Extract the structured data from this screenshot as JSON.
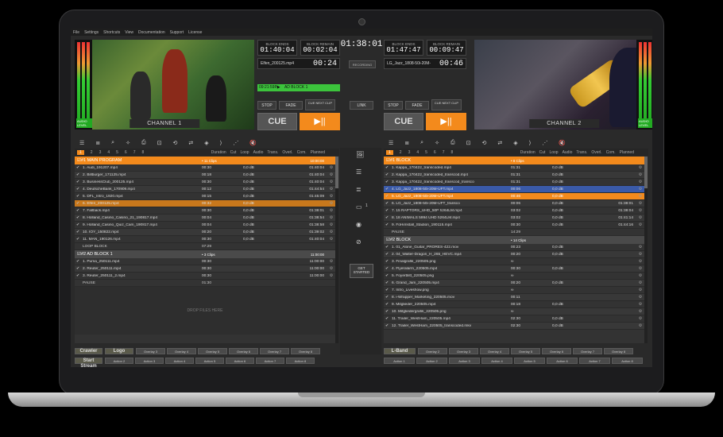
{
  "menu": [
    "File",
    "Settings",
    "Shortcuts",
    "View",
    "Documentation",
    "Support",
    "License"
  ],
  "clock": "01:38:01",
  "recording_label": "RECORDING",
  "link_label": "LINK",
  "channel1": {
    "label": "CHANNEL 1",
    "vu_caption": "AUDIO LEVEL",
    "block_ends_label": "BLOCK ENDS",
    "block_ends": "01:40:04",
    "block_remain_label": "BLOCK REMAIN",
    "block_remain": "00:02:04",
    "file": "Elfen_200125.mp4",
    "countdown": "00:24",
    "ad_time": "09:21:59P▶",
    "ad_label": "AD BLOCK 1",
    "stop": "STOP",
    "fade": "FADE",
    "cue_next": "CUE NEXT CLIP",
    "cue": "CUE",
    "play": "▶||"
  },
  "channel2": {
    "label": "CHANNEL 2",
    "vu_caption": "AUDIO LEVEL",
    "block_ends_label": "BLOCK ENDS",
    "block_ends": "01:47:47",
    "block_remain_label": "BLOCK REMAIN",
    "block_remain": "00:09:47",
    "file": "LG_Jazz_1808-50i-20M-",
    "countdown": "00:46",
    "stop": "STOP",
    "fade": "FADE",
    "cue_next": "CUE NEXT CLIP",
    "cue": "CUE",
    "play": "▶||"
  },
  "toolbar_icons": [
    "list-icon",
    "playlist-icon",
    "zoom-icon",
    "magic-icon",
    "print-icon",
    "lock-icon",
    "loop-icon",
    "shuffle-icon",
    "layers-icon",
    "arrow-icon",
    "transition-icon",
    "mute-icon"
  ],
  "tabs": [
    "1",
    "2",
    "3",
    "4",
    "5",
    "6",
    "7",
    "8"
  ],
  "columns": [
    "Duration",
    "Cut",
    "Loop",
    "Audio",
    "Trans.",
    "Overl.",
    "Com.",
    "Planned"
  ],
  "left_playlist": {
    "groups": [
      {
        "title": "#1  MAIN PROGRAM",
        "count": "• 11 Clips",
        "time": "10:00:00",
        "style": "orange",
        "rows": [
          {
            "name": "1. Audi_191207.mp4",
            "dur": "00:30",
            "audio": "0,0 dB",
            "planned": "01:40:04",
            "state": ""
          },
          {
            "name": "2. Billburger_171125.mp4",
            "dur": "00:18",
            "audio": "0,0 dB",
            "planned": "01:40:04",
            "state": ""
          },
          {
            "name": "3. BusinessClub_200125.mp4",
            "dur": "00:30",
            "audio": "0,0 dB",
            "planned": "01:40:04",
            "state": ""
          },
          {
            "name": "4. DeutscheBank_170909.mp4",
            "dur": "00:12",
            "audio": "0,0 dB",
            "planned": "01:44:54",
            "state": ""
          },
          {
            "name": "5. DFL_Intro_1920.mp4",
            "dur": "00:15",
            "audio": "0,0 dB",
            "planned": "01:45:09",
            "state": ""
          },
          {
            "name": "6. Elfen_200125.mp4",
            "dur": "00:32",
            "audio": "0,0 dB",
            "planned": "",
            "state": "act"
          },
          {
            "name": "7. Fallback.mp4",
            "dur": "00:30",
            "audio": "0,0 dB",
            "planned": "01:38:01",
            "state": ""
          },
          {
            "name": "8. Holland_Casino_Casino_21_190817.mp4",
            "dur": "00:04",
            "audio": "0,0 dB",
            "planned": "01:38:54",
            "state": ""
          },
          {
            "name": "9. Holland_Casino_Quiz_Cam_190817.mp4",
            "dur": "00:04",
            "audio": "0,0 dB",
            "planned": "01:38:58",
            "state": ""
          },
          {
            "name": "10. IOY_150822.mp4",
            "dur": "00:20",
            "audio": "0,0 dB",
            "planned": "01:39:02",
            "state": ""
          },
          {
            "name": "11. MAN_190126.mp4",
            "dur": "00:30",
            "audio": "0,0 dB",
            "planned": "01:40:04",
            "state": ""
          },
          {
            "name": "LOOP BLOCK",
            "dur": "07:29",
            "audio": "",
            "planned": "",
            "state": "plain"
          }
        ]
      },
      {
        "title": "#2  AD BLOCK 1",
        "count": "• 3 Clips",
        "time": "11:00:00",
        "style": "grey",
        "rows": [
          {
            "name": "1. Puma_250111.mp4",
            "dur": "00:30",
            "audio": "",
            "planned": "11:00:00",
            "state": ""
          },
          {
            "name": "2. Reuter_250111.mp4",
            "dur": "00:30",
            "audio": "",
            "planned": "11:00:00",
            "state": ""
          },
          {
            "name": "3. Reuter_250111_2.mp4",
            "dur": "00:30",
            "audio": "",
            "planned": "11:00:00",
            "state": ""
          },
          {
            "name": "PAUSE",
            "dur": "01:30",
            "audio": "",
            "planned": "",
            "state": "plain"
          }
        ]
      }
    ],
    "drop_text": "DROP FILES HERE"
  },
  "right_playlist": {
    "groups": [
      {
        "title": "#1  BLOCK",
        "count": "• 8 Clips",
        "time": "",
        "style": "orange",
        "rows": [
          {
            "name": "1. Kappa_170422_transcoded.mp4",
            "dur": "01:31",
            "audio": "0,0 dB",
            "planned": "",
            "state": ""
          },
          {
            "name": "2. Kappa_170422_transcoded_transcod.mp4",
            "dur": "01:31",
            "audio": "0,0 dB",
            "planned": "",
            "state": ""
          },
          {
            "name": "3. Kappa_170422_transcoded_transcod_transco",
            "dur": "01:31",
            "audio": "0,0 dB",
            "planned": "",
            "state": ""
          },
          {
            "name": "4. LG_Jazz_1808-50i-20M-UFT.mp4",
            "dur": "00:06",
            "audio": "0,0 dB",
            "planned": "",
            "state": "sel"
          },
          {
            "name": "5. LG_Jazz_1808-50i-20M-UFT.mp4",
            "dur": "00:46",
            "audio": "0,0 dB",
            "planned": "",
            "state": "ora"
          },
          {
            "name": "6. LG_Jazz_1808-50i-20M-UFT_transco",
            "dur": "00:06",
            "audio": "0,0 dB",
            "planned": "01:38:01",
            "state": ""
          },
          {
            "name": "7. 15 RAPTORS_UHD_50P h264LM.mp4",
            "dur": "03:02",
            "audio": "0,0 dB",
            "planned": "01:38:04",
            "state": ""
          },
          {
            "name": "8. 18 ANIMALS 5994 UHD h264LM.mp4",
            "dur": "03:02",
            "audio": "0,0 dB",
            "planned": "01:41:14",
            "state": ""
          },
          {
            "name": "9. FoHimstall_Stadion_190115.mp4",
            "dur": "00:30",
            "audio": "0,0 dB",
            "planned": "01:44:16",
            "state": ""
          },
          {
            "name": "PAUSE",
            "dur": "14:29",
            "audio": "",
            "planned": "",
            "state": "plain"
          }
        ]
      },
      {
        "title": "#2  BLOCK",
        "count": "• 14 Clips",
        "time": "",
        "style": "grey",
        "rows": [
          {
            "name": "1. 01_Alone_Guitar_PRORES-422.mov",
            "dur": "00:23",
            "audio": "0,0 dB",
            "planned": "",
            "state": ""
          },
          {
            "name": "2. 04_Walter-Dragon_H_265_HEVC.mp4",
            "dur": "00:20",
            "audio": "0,0 dB",
            "planned": "",
            "state": ""
          },
          {
            "name": "3. Finalgrafik_220505.png",
            "dur": "∞",
            "audio": "",
            "planned": "",
            "state": ""
          },
          {
            "name": "4. Flyeralarm_220505.mp4",
            "dur": "00:30",
            "audio": "0,0 dB",
            "planned": "",
            "state": ""
          },
          {
            "name": "5. Foyerblitt_220505.png",
            "dur": "∞",
            "audio": "",
            "planned": "",
            "state": ""
          },
          {
            "name": "6. Grand_Jam_220505.mp4",
            "dur": "00:20",
            "audio": "0,0 dB",
            "planned": "",
            "state": ""
          },
          {
            "name": "7. Intro_Liveshow.png",
            "dur": "∞",
            "audio": "",
            "planned": "",
            "state": ""
          },
          {
            "name": "8. i-Wrapper_Marketing_220505.mov",
            "dur": "00:11",
            "audio": "",
            "planned": "",
            "state": ""
          },
          {
            "name": "9. Mitglieder_220505.mp4",
            "dur": "00:18",
            "audio": "0,0 dB",
            "planned": "",
            "state": ""
          },
          {
            "name": "10. Mitgliedergrafik_220505.png",
            "dur": "∞",
            "audio": "",
            "planned": "",
            "state": ""
          },
          {
            "name": "11. Trailer_WestHam_220505.mp4",
            "dur": "02:30",
            "audio": "0,0 dB",
            "planned": "",
            "state": ""
          },
          {
            "name": "12. Trailer_WestHam_220505_transcoded.mkv",
            "dur": "02:30",
            "audio": "0,0 dB",
            "planned": "",
            "state": ""
          }
        ]
      }
    ]
  },
  "side_icons": [
    "image-icon",
    "list-icon",
    "playlist-icon",
    "camera-icon",
    "broadcast-icon",
    "compass-icon"
  ],
  "side_camera_text": "1",
  "get_started": "GET STARTED",
  "left_overlays": {
    "row1_big": [
      "Crawler",
      "Logo"
    ],
    "row1": [
      "Overlay 3",
      "Overlay 4",
      "Overlay 5",
      "Overlay 6",
      "Overlay 7",
      "Overlay 8"
    ],
    "row2_big": "Start Stream",
    "row2": [
      "Action 2",
      "Action 3",
      "Action 4",
      "Action 5",
      "Action 6",
      "Action 7",
      "Action 8"
    ]
  },
  "right_overlays": {
    "row1_big": "L-Band",
    "row1": [
      "Overlay 2",
      "Overlay 3",
      "Overlay 4",
      "Overlay 5",
      "Overlay 6",
      "Overlay 7",
      "Overlay 8"
    ],
    "row2": [
      "Action 1",
      "Action 2",
      "Action 3",
      "Action 4",
      "Action 5",
      "Action 6",
      "Action 7",
      "Action 8"
    ]
  }
}
